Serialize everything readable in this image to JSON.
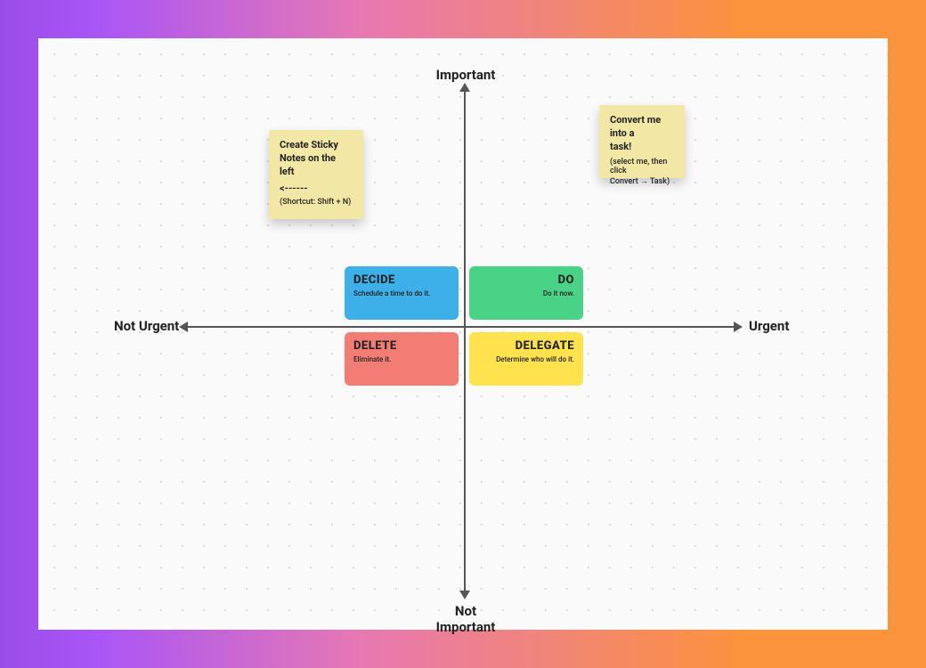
{
  "axes": {
    "top": "Important",
    "bottom_line1": "Not",
    "bottom_line2": "Important",
    "left": "Not Urgent",
    "right": "Urgent"
  },
  "quadrants": {
    "decide": {
      "title": "DECIDE",
      "sub": "Schedule a time to do it."
    },
    "do": {
      "title": "DO",
      "sub": "Do it now."
    },
    "delete": {
      "title": "DELETE",
      "sub": "Eliminate it."
    },
    "delegate": {
      "title": "DELEGATE",
      "sub": "Determine who will do it."
    }
  },
  "stickies": {
    "left": {
      "line1": "Create Sticky",
      "line2": "Notes on the left",
      "arrow": "<------",
      "shortcut": "(Shortcut: Shift + N)"
    },
    "right": {
      "heading1": "Convert me into a",
      "heading2": "task!",
      "body1": "(select me, then click",
      "body2": "Convert → Task)"
    }
  },
  "colors": {
    "decide": "#3db0ea",
    "do": "#4ad386",
    "delete": "#f37d75",
    "delegate": "#ffe24d",
    "sticky": "#f3e7a6",
    "axis": "#555555"
  }
}
